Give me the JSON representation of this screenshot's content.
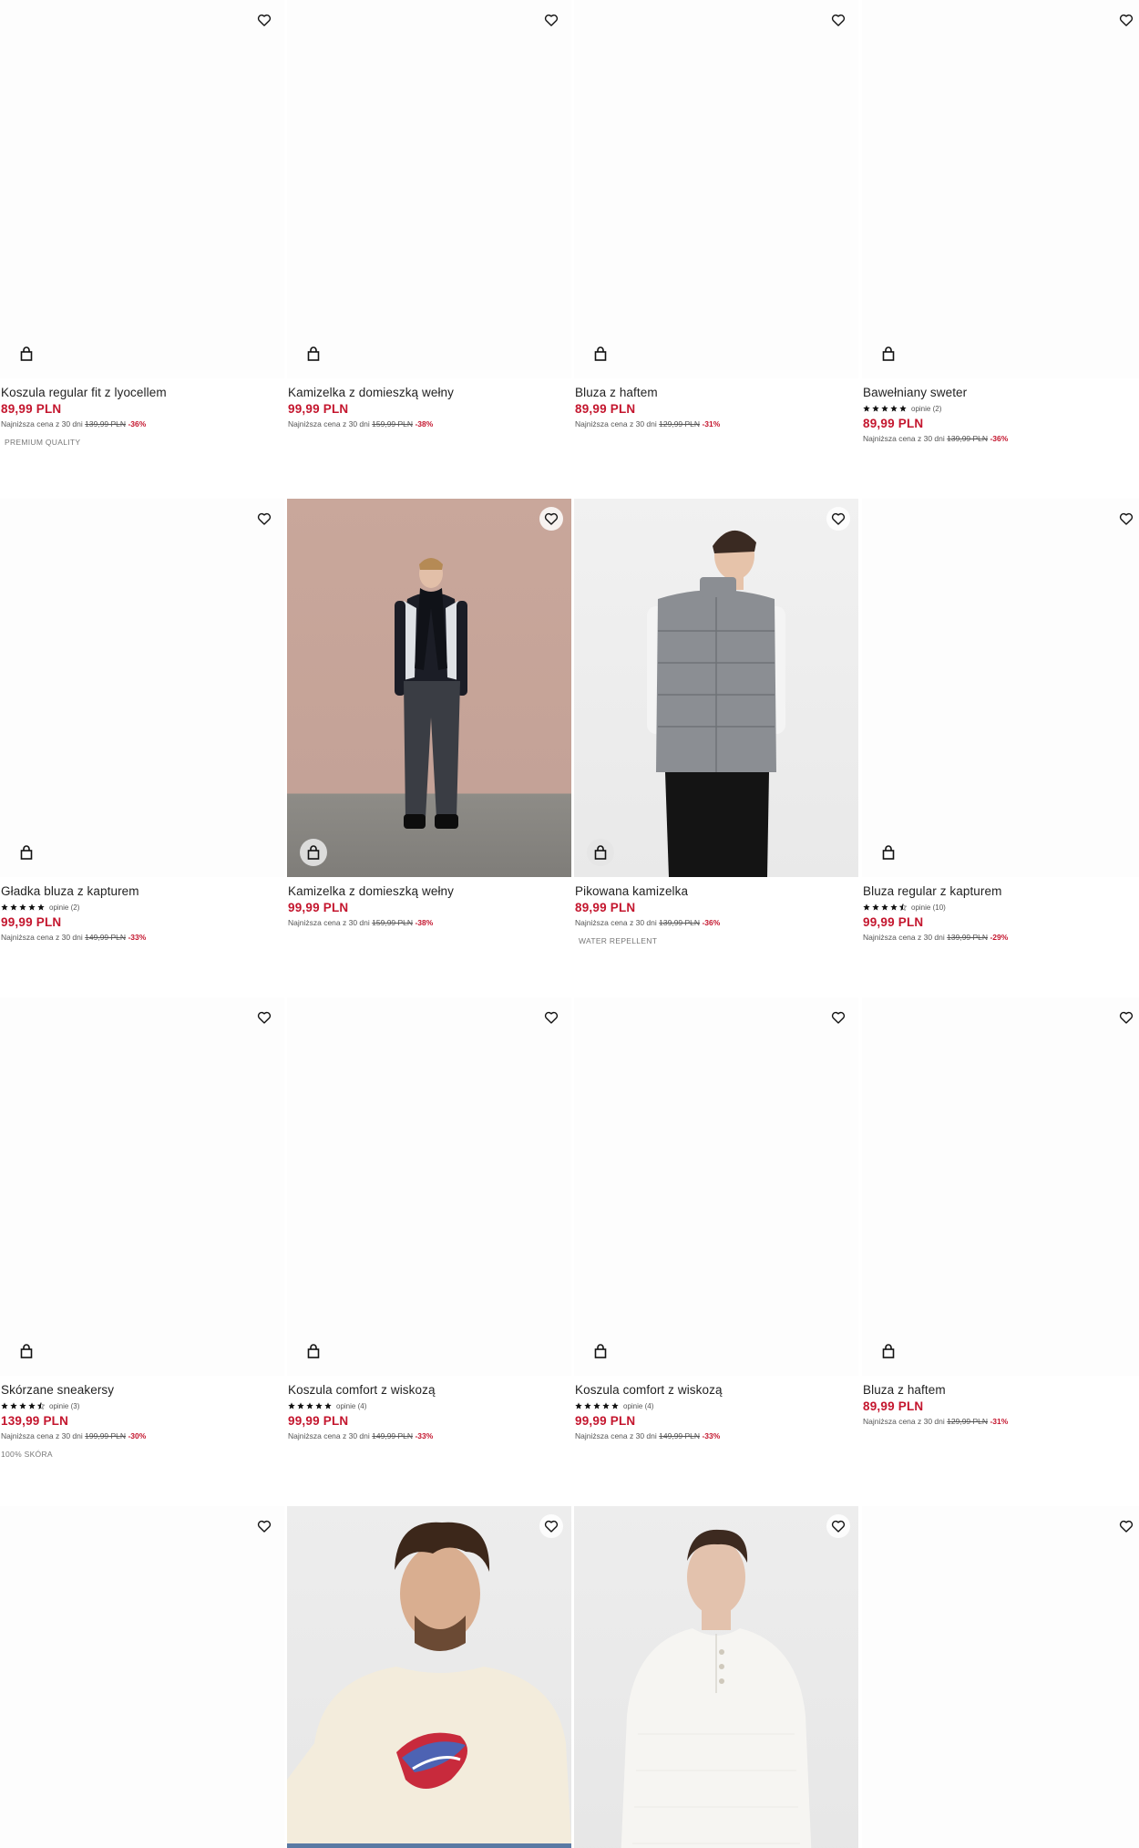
{
  "products": [
    {
      "name": "Koszula regular fit z lyocellem",
      "price": "89,99 PLN",
      "lowest_label": "Najniższa cena z 30 dni",
      "old_price": "139,99 PLN",
      "discount": "-36%",
      "tag": "PREMIUM QUALITY",
      "rating": null,
      "reviews": null,
      "image": "blank"
    },
    {
      "name": "Kamizelka z domieszką wełny",
      "price": "99,99 PLN",
      "lowest_label": "Najniższa cena z 30 dni",
      "old_price": "159,99 PLN",
      "discount": "-38%",
      "tag": null,
      "rating": null,
      "reviews": null,
      "image": "blank"
    },
    {
      "name": "Bluza z haftem",
      "price": "89,99 PLN",
      "lowest_label": "Najniższa cena z 30 dni",
      "old_price": "129,99 PLN",
      "discount": "-31%",
      "tag": null,
      "rating": null,
      "reviews": null,
      "image": "blank"
    },
    {
      "name": "Bawełniany sweter",
      "price": "89,99 PLN",
      "lowest_label": "Najniższa cena z 30 dni",
      "old_price": "139,99 PLN",
      "discount": "-36%",
      "tag": null,
      "rating": 5,
      "reviews": "opinie (2)",
      "image": "blank"
    },
    {
      "name": "Gładka bluza z kapturem",
      "price": "99,99 PLN",
      "lowest_label": "Najniższa cena z 30 dni",
      "old_price": "149,99 PLN",
      "discount": "-33%",
      "tag": null,
      "rating": 5,
      "reviews": "opinie (2)",
      "image": "blank"
    },
    {
      "name": "Kamizelka z domieszką wełny",
      "price": "99,99 PLN",
      "lowest_label": "Najniższa cena z 30 dni",
      "old_price": "159,99 PLN",
      "discount": "-38%",
      "tag": null,
      "rating": null,
      "reviews": null,
      "image": "model-vest-scarf"
    },
    {
      "name": "Pikowana kamizelka",
      "price": "89,99 PLN",
      "lowest_label": "Najniższa cena z 30 dni",
      "old_price": "139,99 PLN",
      "discount": "-36%",
      "tag": "WATER REPELLENT",
      "rating": null,
      "reviews": null,
      "image": "model-quilted-vest"
    },
    {
      "name": "Bluza regular z kapturem",
      "price": "99,99 PLN",
      "lowest_label": "Najniższa cena z 30 dni",
      "old_price": "139,99 PLN",
      "discount": "-29%",
      "tag": null,
      "rating": 4.5,
      "reviews": "opinie (10)",
      "image": "blank"
    },
    {
      "name": "Skórzane sneakersy",
      "price": "139,99 PLN",
      "lowest_label": "Najniższa cena z 30 dni",
      "old_price": "199,99 PLN",
      "discount": "-30%",
      "tag": "100% SKÓRA",
      "rating": 4.5,
      "reviews": "opinie (3)",
      "image": "blank"
    },
    {
      "name": "Koszula comfort z wiskozą",
      "price": "99,99 PLN",
      "lowest_label": "Najniższa cena z 30 dni",
      "old_price": "149,99 PLN",
      "discount": "-33%",
      "tag": null,
      "rating": 5,
      "reviews": "opinie (4)",
      "image": "blank"
    },
    {
      "name": "Koszula comfort z wiskozą",
      "price": "99,99 PLN",
      "lowest_label": "Najniższa cena z 30 dni",
      "old_price": "149,99 PLN",
      "discount": "-33%",
      "tag": null,
      "rating": 5,
      "reviews": "opinie (4)",
      "image": "blank"
    },
    {
      "name": "Bluza z haftem",
      "price": "89,99 PLN",
      "lowest_label": "Najniższa cena z 30 dni",
      "old_price": "129,99 PLN",
      "discount": "-31%",
      "tag": null,
      "rating": null,
      "reviews": null,
      "image": "blank"
    }
  ],
  "bottom_row": [
    {
      "image": "blank"
    },
    {
      "image": "model-sweatshirt"
    },
    {
      "image": "model-henley"
    },
    {
      "image": "blank"
    }
  ],
  "icons": {
    "favorite": "heart-icon",
    "add_to_cart": "shopping-bag-icon",
    "star": "star-icon"
  },
  "colors": {
    "price": "#c4162e",
    "text": "#222222",
    "muted": "#555555"
  }
}
